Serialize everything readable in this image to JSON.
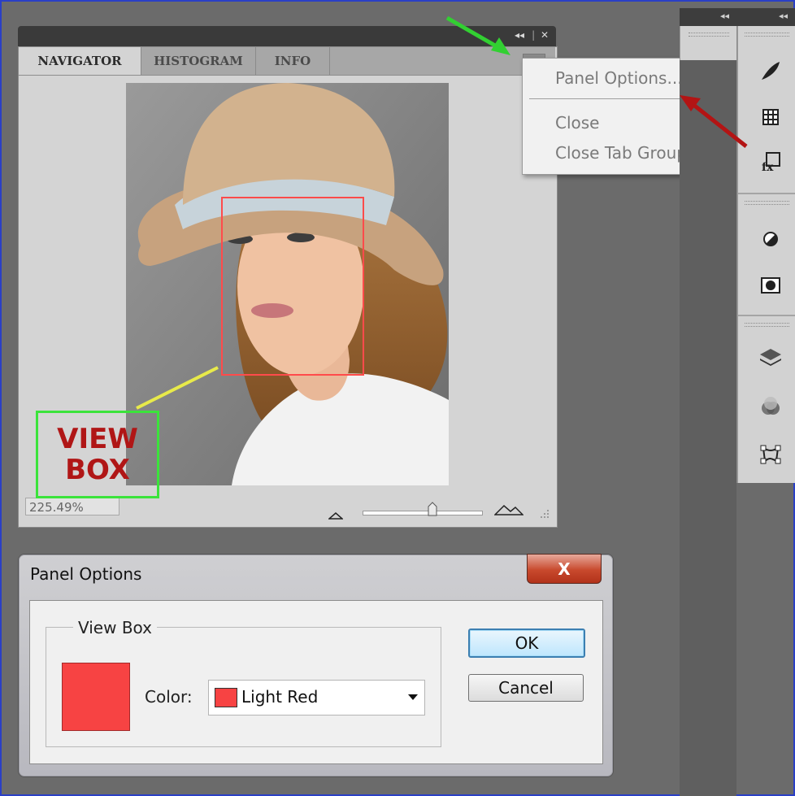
{
  "navigator": {
    "tabs": [
      "NAVIGATOR",
      "HISTOGRAM",
      "INFO"
    ],
    "zoom": "225.49%",
    "collapse_icon": "double-left-arrow",
    "close_icon": "x",
    "menu_icon": "panel-menu-lines"
  },
  "context_menu": {
    "items": [
      "Panel Options...",
      "Close",
      "Close Tab Group"
    ]
  },
  "annotation": {
    "view_box_text": [
      "VIEW",
      "BOX"
    ],
    "view_box_color": "#ff4b4b",
    "arrow_green": "#32d032",
    "arrow_red": "#b31414",
    "leader_yellow": "#e8ea4a"
  },
  "dialog": {
    "title": "Panel Options",
    "close_label": "X",
    "group_label": "View Box",
    "color_label": "Color:",
    "color_value": "Light Red",
    "swatch_color": "#f74343",
    "ok_label": "OK",
    "cancel_label": "Cancel"
  },
  "dock": {
    "collapse_label": "◂◂",
    "icons": [
      "brush-presets-icon",
      "grid-icon",
      "fx-styles-icon",
      "adjustment-circle-icon",
      "mask-icon",
      "layers-icon",
      "channels-icon",
      "paths-icon"
    ]
  }
}
